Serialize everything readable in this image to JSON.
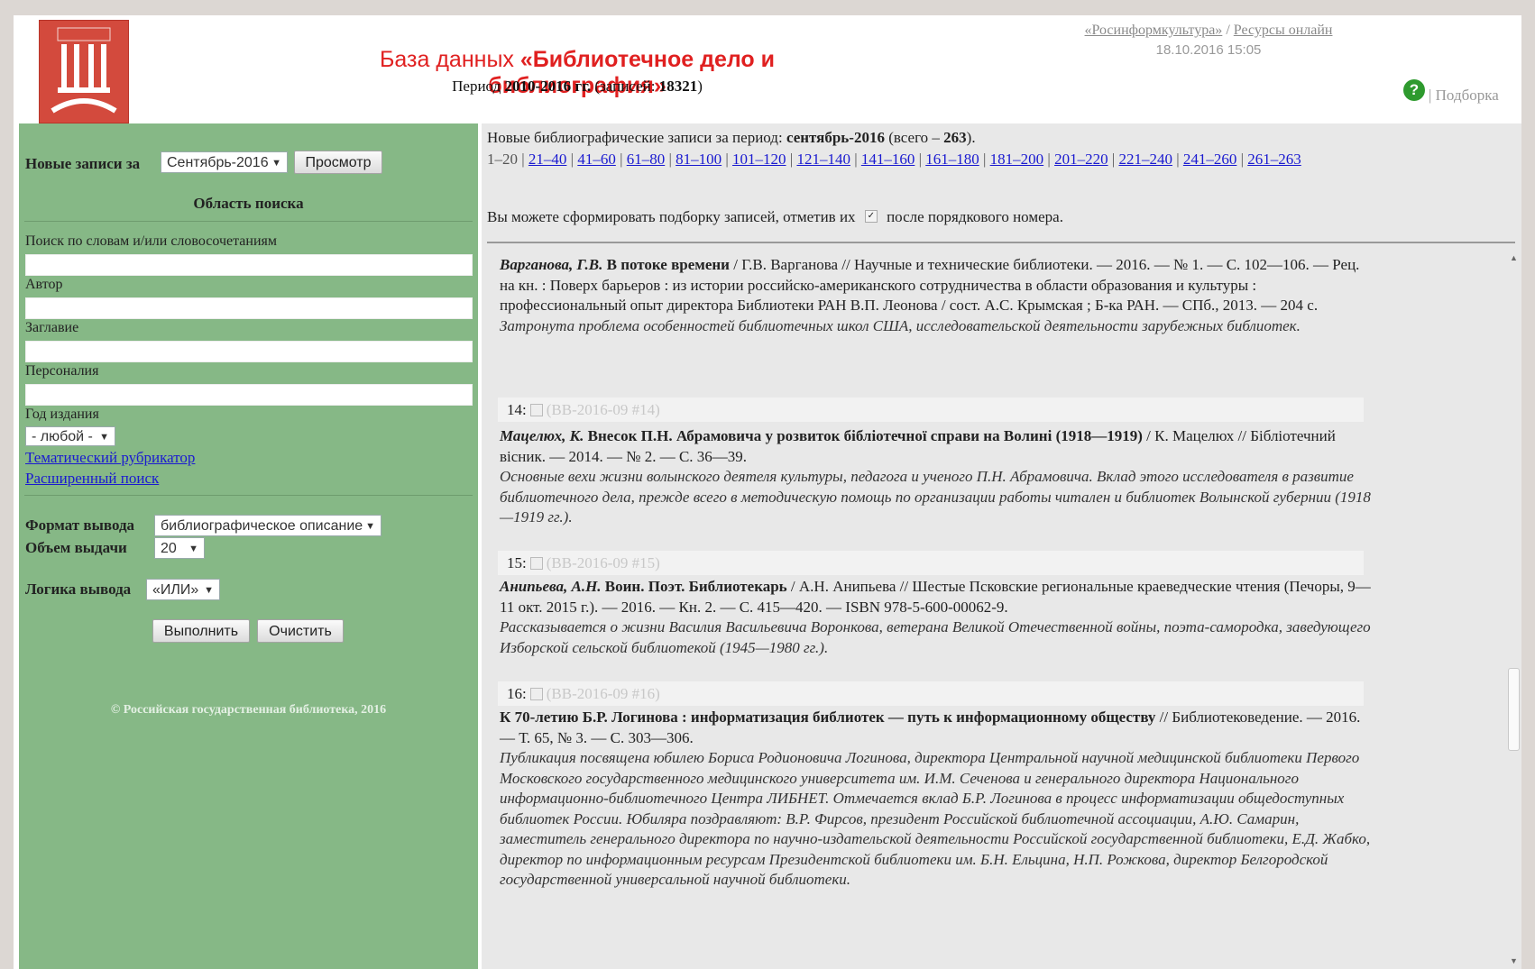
{
  "header": {
    "title_prefix": "База данных ",
    "title_main": "«Библиотечное дело и библиография»",
    "period_prefix": "Период ",
    "period_years": "2010-2016 гг.",
    "period_records_label": " (записей: ",
    "period_records": "18321",
    "period_suffix": ")",
    "link_rosinform": "«Росинформкультура»",
    "link_sep": " / ",
    "link_resources": "Ресурсы онлайн",
    "datetime": "18.10.2016 15:05",
    "help_glyph": "?",
    "podborka": "| Подборка"
  },
  "left": {
    "new_records_label": "Новые записи за",
    "month_select": "Сентябрь-2016",
    "view_button": "Просмотр",
    "search_area_title": "Область поиска",
    "words_label": "Поиск по словам и/или словосочетаниям",
    "author_label": "Автор",
    "title_label": "Заглавие",
    "persona_label": "Персоналия",
    "year_label": "Год издания",
    "year_select": "- любой -",
    "thematic_link": "Тематический рубрикатор",
    "advanced_link": "Расширенный поиск",
    "format_label": "Формат вывода",
    "format_select": "библиографическое описание",
    "volume_label": "Объем выдачи",
    "volume_select": "20",
    "logic_label": "Логика вывода",
    "logic_select": "«ИЛИ»",
    "execute_button": "Выполнить",
    "clear_button": "Очистить",
    "copyright": "© Российская государственная библиотека, 2016"
  },
  "right": {
    "new_records_prefix": "Новые библиографические записи за период: ",
    "new_records_period": "сентябрь-2016",
    "new_records_total_prefix": " (всего – ",
    "new_records_total": "263",
    "new_records_total_suffix": ").",
    "pager_current": "1–20",
    "pager_links": [
      "21–40",
      "41–60",
      "61–80",
      "81–100",
      "101–120",
      "121–140",
      "141–160",
      "161–180",
      "181–200",
      "201–220",
      "221–240",
      "241–260",
      "261–263"
    ],
    "hint_prefix": "Вы можете сформировать подборку записей, отметив их",
    "hint_suffix": "после порядкового номера.",
    "records": [
      {
        "author": "Варганова, Г.В.",
        "title": " В потоке времени",
        "desc": " / Г.В. Варганова  // Научные и технические библиотеки. — 2016. — № 1. — С. 102—106. — Рец. на кн. : Поверх барьеров : из истории российско-американского сотрудничества в области образования и культуры : профессиональный опыт директора Библиотеки РАН В.П. Леонова  / сост. А.С. Крымская ; Б-ка РАН. — СПб., 2013. — 204 с.",
        "annotation": "Затронута проблема особенностей библиотечных школ США, исследовательской деятельности зарубежных библиотек."
      },
      {
        "num": "14:",
        "code": "(ВВ-2016-09 #14)",
        "author": "Мацелюх, К.",
        "title": " Внесок П.Н. Абрамовича у розвиток бібліотечної справи на Волині (1918—1919)",
        "desc": " / К. Мацелюх  // Бібліотечний вісник. — 2014. — № 2. — С. 36—39.",
        "annotation": "Основные вехи жизни волынского деятеля культуры, педагога и ученого П.Н. Абрамовича. Вклад этого исследователя в развитие библиотечного дела, прежде всего в методическую помощь по организации работы читален и библиотек Волынской губернии (1918—1919 гг.)."
      },
      {
        "num": "15:",
        "code": "(ВВ-2016-09 #15)",
        "author": "Анипьева, А.Н.",
        "title": " Воин. Поэт. Библиотекарь",
        "desc": " / А.Н. Анипьева  // Шестые Псковские региональные краеведческие чтения (Печоры, 9—11 окт. 2015 г.). — 2016. — Кн. 2. — С. 415—420. — ISBN 978-5-600-00062-9.",
        "annotation": "Рассказывается о жизни Василия Васильевича Воронкова, ветерана Великой Отечественной войны, поэта-самородка, заведующего Изборской сельской библиотекой (1945—1980 гг.)."
      },
      {
        "num": "16:",
        "code": "(ВВ-2016-09 #16)",
        "author": "",
        "title": "К 70-летию Б.Р. Логинова : информатизация библиотек — путь к информационному обществу",
        "desc": " // Библиотековедение. — 2016. — Т. 65, № 3. — С. 303—306.",
        "annotation": "Публикация посвящена юбилею Бориса Родионовича Логинова, директора Центральной научной медицинской библиотеки Первого Московского государственного медицинского университета им. И.М. Сеченова и генерального директора Национального информационно-библиотечного Центра ЛИБНЕТ. Отмечается вклад Б.Р. Логинова в процесс информатизации общедоступных библиотек России. Юбиляра поздравляют: В.Р. Фирсов, президент Российской библиотечной ассоциации, А.Ю. Самарин, заместитель генерального директора по научно-издательской деятельности Российской государственной библиотеки, Е.Д. Жабко, директор по информационным ресурсам Президентской библиотеки им. Б.Н. Ельцина, Н.П. Рожкова, директор Белгородской государственной универсальной научной библиотеки."
      }
    ]
  }
}
